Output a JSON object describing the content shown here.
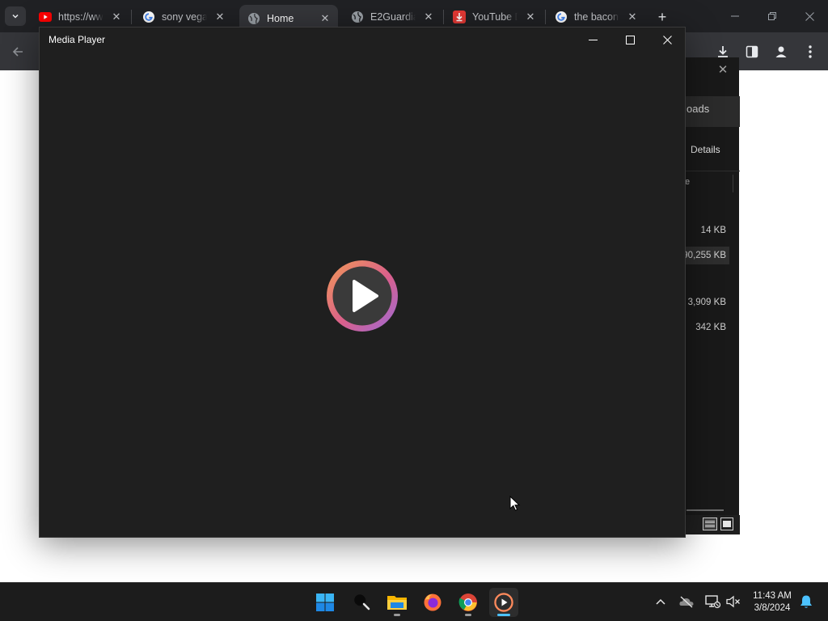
{
  "browser": {
    "tabs": [
      {
        "title": "https://ww",
        "favicon": "youtube-icon",
        "active": false
      },
      {
        "title": "sony vega",
        "favicon": "google-icon",
        "active": false
      },
      {
        "title": "Home",
        "favicon": "globe-icon",
        "active": true
      },
      {
        "title": "E2Guardia",
        "favicon": "globe-icon",
        "active": false
      },
      {
        "title": "YouTube D",
        "favicon": "download-app-icon",
        "active": false
      },
      {
        "title": "the bacon",
        "favicon": "google-icon",
        "active": false
      }
    ],
    "new_tab_label": "+"
  },
  "downloads_window": {
    "header_fragment": "oads",
    "details_label": "Details",
    "column_fragment": "e",
    "sizes": [
      "14 KB",
      "90,255 KB",
      "3,909 KB",
      "342 KB"
    ],
    "selected_index": 1
  },
  "media_player": {
    "title": "Media Player",
    "play_button_colors": [
      "#f29a55",
      "#d95f8c",
      "#9b6bd8"
    ]
  },
  "taskbar": {
    "apps": [
      "windows-start-icon",
      "search-icon",
      "file-explorer-icon",
      "firefox-icon",
      "chrome-icon",
      "media-player-icon"
    ],
    "clock_time": "11:43 AM",
    "clock_date": "3/8/2024"
  }
}
